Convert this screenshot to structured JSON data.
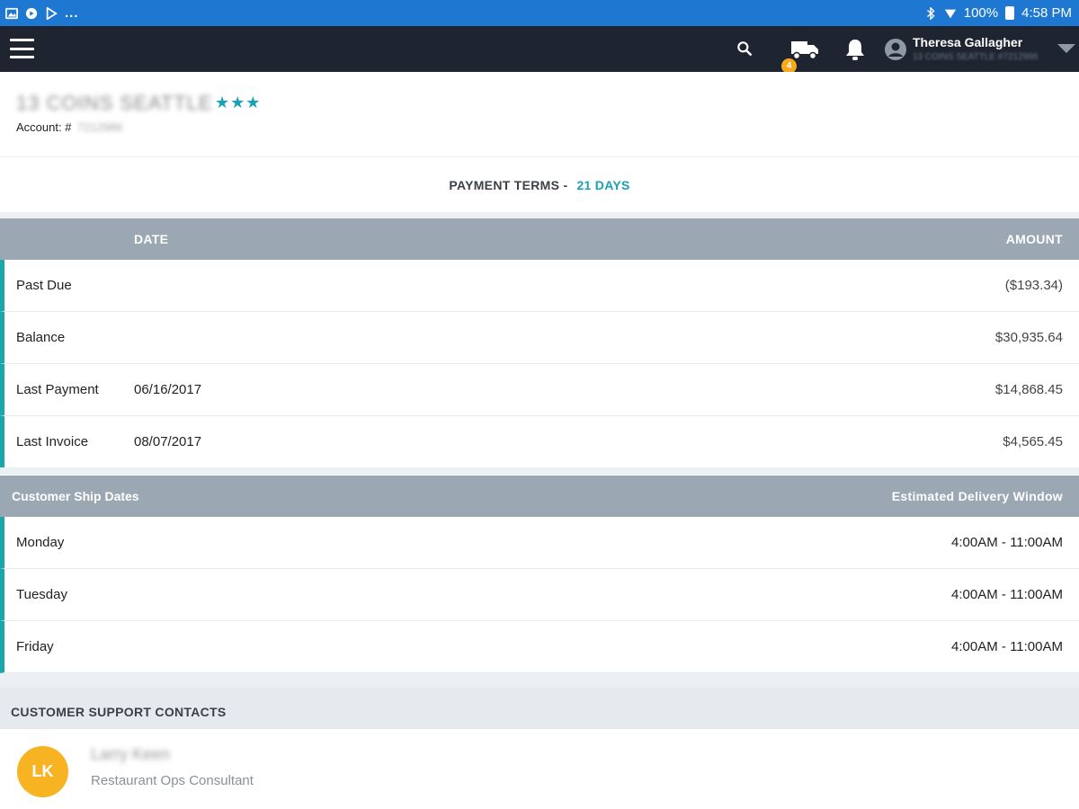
{
  "status_bar": {
    "left_overflow": "...",
    "battery": "100%",
    "time": "4:58 PM",
    "icons_left": [
      "gallery-icon",
      "circle-app-icon",
      "play-store-icon"
    ],
    "icons_right": [
      "bluetooth-icon",
      "wifi-icon",
      "battery-icon"
    ]
  },
  "app_bar": {
    "menu_icon": "hamburger-icon",
    "search_icon": "search-icon",
    "truck_icon": "truck-icon",
    "truck_badge": "4",
    "bell_icon": "bell-icon",
    "user_icon": "account-circle-icon",
    "user_name": "Theresa Gallagher",
    "user_subtitle": "13 COINS SEATTLE #7212986",
    "colors": {
      "bar": "#1e2531",
      "badge": "#f7a81b"
    }
  },
  "account": {
    "name": "13 COINS SEATTLE",
    "stars": "★★★",
    "account_label": "Account: #",
    "account_number": "7212986"
  },
  "payment_terms": {
    "label": "PAYMENT TERMS -",
    "value": "21 DAYS"
  },
  "balances": {
    "columns": {
      "date": "DATE",
      "amount": "AMOUNT"
    },
    "rows": [
      {
        "label": "Past Due",
        "date": "",
        "amount": "($193.34)"
      },
      {
        "label": "Balance",
        "date": "",
        "amount": "$30,935.64"
      },
      {
        "label": "Last Payment",
        "date": "06/16/2017",
        "amount": "$14,868.45"
      },
      {
        "label": "Last Invoice",
        "date": "08/07/2017",
        "amount": "$4,565.45"
      }
    ]
  },
  "ship_dates": {
    "columns": {
      "day": "Customer Ship Dates",
      "window": "Estimated Delivery Window"
    },
    "rows": [
      {
        "day": "Monday",
        "window": "4:00AM - 11:00AM"
      },
      {
        "day": "Tuesday",
        "window": "4:00AM - 11:00AM"
      },
      {
        "day": "Friday",
        "window": "4:00AM - 11:00AM"
      }
    ]
  },
  "support": {
    "heading": "CUSTOMER SUPPORT CONTACTS",
    "contacts": [
      {
        "initials": "LK",
        "name": "Larry Keen",
        "role": "Restaurant Ops Consultant"
      }
    ]
  },
  "colors": {
    "accent": "#1ba1b5",
    "row_marker": "#19a7ab",
    "header_gray": "#9ba8b3",
    "avatar": "#f8b323",
    "status_bar": "#1e78d2"
  }
}
